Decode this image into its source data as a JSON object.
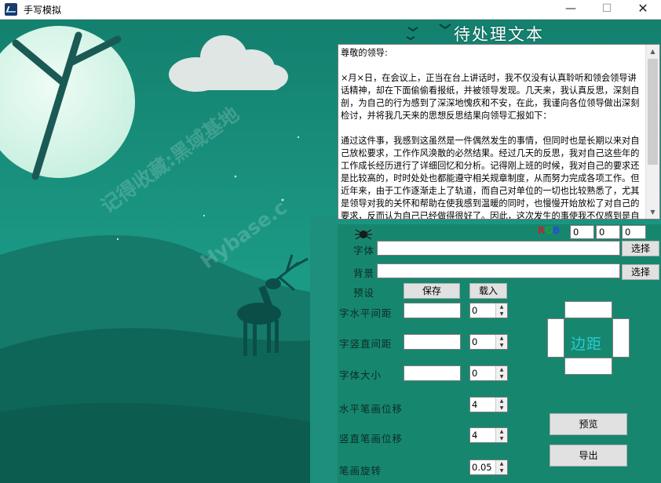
{
  "window": {
    "title": "手写模拟",
    "min_glyph": "—",
    "max_glyph": "☐",
    "close_glyph": "✕"
  },
  "header": {
    "title": "待处理文本"
  },
  "text_area": {
    "content": "尊敬的领导:\n\n×月×日，在会议上，正当在台上讲话时，我不仅没有认真聆听和领会领导讲话精神，却在下面偷偷看报纸，并被领导发现。几天来，我认真反思，深刻自剖，为自己的行为感到了深深地愧疚和不安，在此，我谨向各位领导做出深刻检讨，并将我几天来的思想反思结果向领导汇报如下：\n\n通过这件事，我感到这虽然是一件偶然发生的事情，但同时也是长期以来对自己放松要求，工作作风涣散的必然结果。经过几天的反思，我对自己这些年的工作成长经历进行了详细回忆和分析。记得刚上班的时候，我对自己的要求还是比较高的，时时处处也都能遵守相关规章制度，从而努力完成各项工作。但近年来，由于工作逐渐走上了轨道，而自己对单位的一切也比较熟悉了，尤其是领导对我的关怀和帮助在使我感到温暖的同时，也慢慢开始放松了对自己的要求，反而认为自己已经做得很好了。因此，这次发生的事使我不仅感到是自己的耻辱，更为重要的是我感到对不起领导对我的信任，愧对领导的关心。"
  },
  "rgb": {
    "r_label": "R",
    "g_label": "G",
    "b_label": "B",
    "r_value": "0",
    "g_value": "0",
    "b_value": "0"
  },
  "font": {
    "label": "字体",
    "value": "",
    "button": "选择"
  },
  "background": {
    "label": "背景",
    "value": "",
    "button": "选择"
  },
  "preset": {
    "label": "预设",
    "save": "保存",
    "load": "载入"
  },
  "h_spacing": {
    "label": "字水平间距",
    "value": "",
    "spin": "0"
  },
  "v_spacing": {
    "label": "字竖直间距",
    "value": "",
    "spin": "0"
  },
  "font_size": {
    "label": "字体大小",
    "value": "",
    "spin": "0"
  },
  "h_stroke": {
    "label": "水平笔画位移",
    "spin": "4"
  },
  "v_stroke": {
    "label": "竖直笔画位移",
    "spin": "4"
  },
  "stroke_rotation": {
    "label": "笔画旋转",
    "spin": "0.05"
  },
  "margin": {
    "label": "边距",
    "top": "",
    "left": "",
    "right": "",
    "bottom": ""
  },
  "buttons": {
    "preview": "预览",
    "export": "导出"
  },
  "watermark": {
    "line1": "记得收藏:黑域基地",
    "line2": "Hybase.c"
  },
  "colors": {
    "accent": "#1a8a78",
    "title_text": "#ffffff",
    "margin_label": "#2bcad0"
  }
}
